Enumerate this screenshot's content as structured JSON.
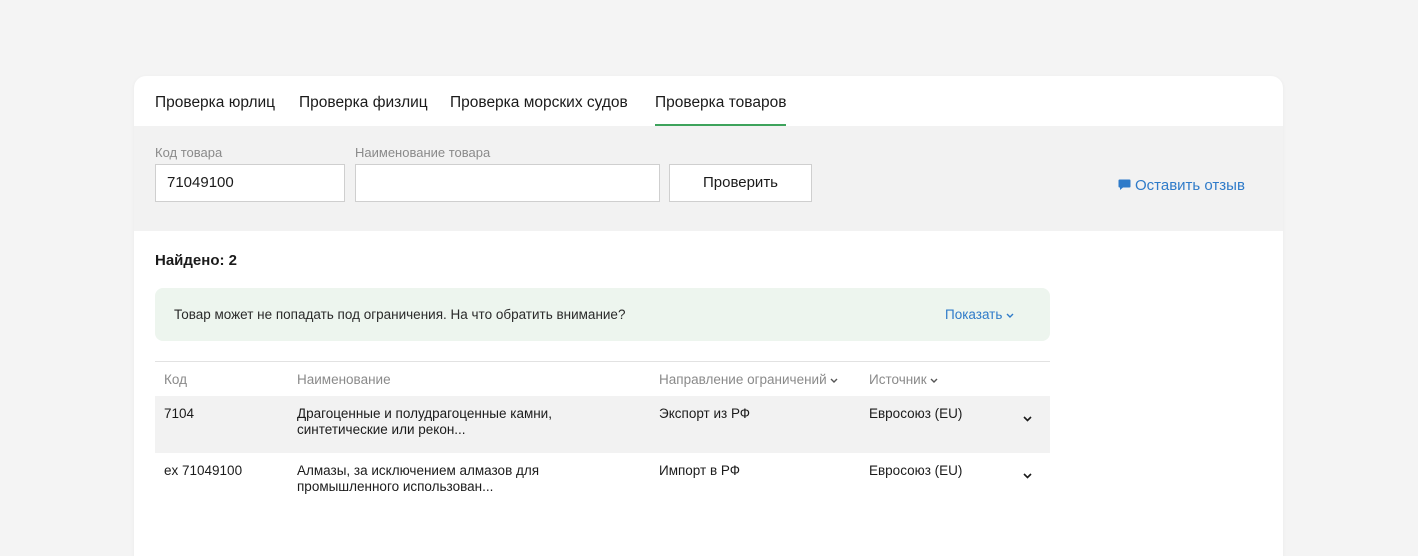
{
  "tabs": [
    {
      "label": "Проверка юрлиц"
    },
    {
      "label": "Проверка физлиц"
    },
    {
      "label": "Проверка морских судов"
    },
    {
      "label": "Проверка товаров",
      "active": true
    }
  ],
  "filters": {
    "code_label": "Код товара",
    "code_value": "71049100",
    "name_label": "Наименование товара",
    "name_value": "",
    "check_button": "Проверить"
  },
  "feedback": {
    "label": "Оставить отзыв",
    "icon": "chat-bubble-icon"
  },
  "results": {
    "found_label": "Найдено: 2"
  },
  "notice": {
    "text": "Товар может не попадать под ограничения. На что обратить внимание?",
    "link": "Показать"
  },
  "table": {
    "headers": [
      "Код",
      "Наименование",
      "Направление ограничений",
      "Источник"
    ],
    "rows": [
      {
        "code": "7104",
        "name_line1": "Драгоценные и полудрагоценные камни,",
        "name_line2": "синтетические или рекон...",
        "direction": "Экспорт из РФ",
        "source": "Евросоюз (EU)"
      },
      {
        "code": "ex 71049100",
        "name_line1": "Алмазы, за исключением алмазов для",
        "name_line2": "промышленного использован...",
        "direction": "Импорт в РФ",
        "source": "Евросоюз (EU)"
      }
    ]
  },
  "colors": {
    "accent_green": "#3ea35c",
    "link_blue": "#2f7bc9"
  }
}
